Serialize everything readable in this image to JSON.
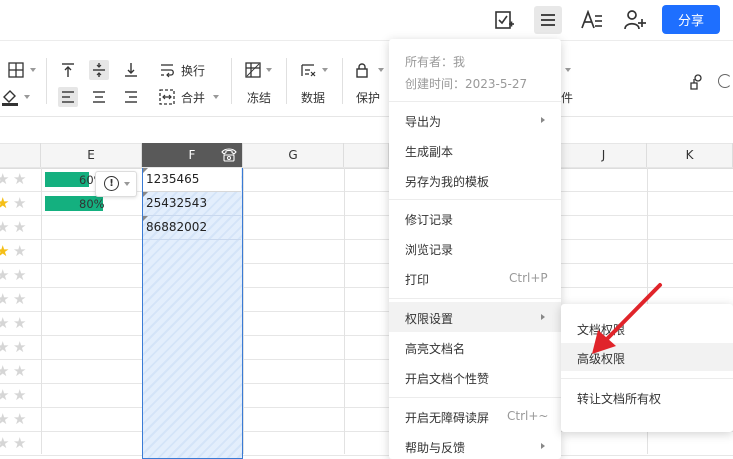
{
  "topbar": {
    "icons": [
      "checkin-icon",
      "menu-icon",
      "font-format-icon",
      "add-user-icon"
    ],
    "share_label": "分享"
  },
  "toolbar": {
    "wrap_label": "换行",
    "merge_label": "合并",
    "freeze_label": "冻结",
    "data_label": "数据",
    "protect_label": "保护",
    "partial_label": "件"
  },
  "grid": {
    "columns": [
      "E",
      "F",
      "G",
      "J",
      "K"
    ],
    "rows": [
      {
        "stars": [
          false,
          false
        ],
        "progress": 0.6,
        "progress_label": "60%",
        "phone": "1235465"
      },
      {
        "stars": [
          true,
          false
        ],
        "progress": 0.8,
        "progress_label": "80%",
        "phone": "25432543"
      },
      {
        "stars": [
          false,
          false
        ],
        "progress": null,
        "progress_label": "",
        "phone": "86882002"
      },
      {
        "stars": [
          true,
          false
        ]
      },
      {
        "stars": [
          false,
          false
        ]
      },
      {
        "stars": [
          false,
          false
        ]
      },
      {
        "stars": [
          false,
          false
        ]
      },
      {
        "stars": [
          false,
          false
        ]
      },
      {
        "stars": [
          false,
          false
        ]
      },
      {
        "stars": [
          false,
          false
        ]
      },
      {
        "stars": [
          false,
          false
        ]
      },
      {
        "stars": [
          false,
          false
        ]
      }
    ]
  },
  "menu": {
    "owner": "所有者：我",
    "created": "创建时间：2023-5-27",
    "items": [
      {
        "label": "导出为",
        "submenu": true
      },
      {
        "label": "生成副本"
      },
      {
        "label": "另存为我的模板"
      },
      {
        "label": "修订记录"
      },
      {
        "label": "浏览记录"
      },
      {
        "label": "打印",
        "shortcut": "Ctrl+P"
      },
      {
        "label": "权限设置",
        "submenu": true,
        "active": true
      },
      {
        "label": "高亮文档名"
      },
      {
        "label": "开启文档个性赞"
      },
      {
        "label": "开启无障碍读屏",
        "shortcut": "Ctrl+~"
      },
      {
        "label": "帮助与反馈",
        "submenu": true
      }
    ]
  },
  "submenu": {
    "items": [
      {
        "label": "文档权限"
      },
      {
        "label": "高级权限",
        "hover": true
      },
      {
        "label": "转让文档所有权"
      }
    ]
  },
  "colors": {
    "accent": "#1e6fff",
    "progress": "#14b07f",
    "star": "#f5bf17",
    "arrow": "#e0242a"
  }
}
